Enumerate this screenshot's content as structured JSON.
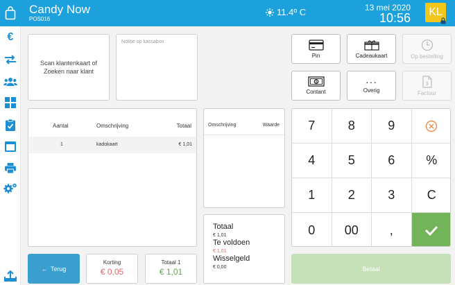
{
  "header": {
    "title": "Candy Now",
    "subtitle": "POS016",
    "temperature": "11.4º C",
    "date": "13 mei 2020",
    "time": "10:56",
    "user_initials": "KL",
    "accent_color": "#1da1dc",
    "avatar_color": "#f3c61b"
  },
  "sidebar": {
    "items": [
      {
        "icon": "euro-icon"
      },
      {
        "icon": "transfer-arrows-icon"
      },
      {
        "icon": "customers-icon"
      },
      {
        "icon": "grid-icon"
      },
      {
        "icon": "checklist-icon"
      },
      {
        "icon": "window-icon"
      },
      {
        "icon": "printer-icon"
      },
      {
        "icon": "settings-gears-icon"
      },
      {
        "icon": "upload-icon"
      }
    ]
  },
  "scan": {
    "text": "Scan klantenkaart of Zoeken naar klant"
  },
  "note": {
    "placeholder": "Notitie op kassabon"
  },
  "orders": {
    "headers": {
      "qty": "Aantal",
      "desc": "Omschrijving",
      "total": "Totaal"
    },
    "rows": [
      {
        "qty": "1",
        "desc": "kadokaart",
        "total": "€ 1,01"
      }
    ]
  },
  "vouchers": {
    "headers": {
      "desc": "Omschrijving",
      "value": "Waarde"
    }
  },
  "totals": {
    "total_label": "Totaal",
    "total_value": "€ 1,01",
    "due_label": "Te voldoen",
    "due_value": "€ 1,01",
    "change_label": "Wisselgeld",
    "change_value": "€ 0,00"
  },
  "buttons": {
    "back_label": "Terug",
    "discount_label": "Korting",
    "discount_value": "€ 0,05",
    "total1_label": "Totaal 1",
    "total1_value": "€ 1,01",
    "pay_label": "Betaal"
  },
  "payment_methods": {
    "pin": "Pin",
    "giftcard": "Cadeaukaart",
    "on_order": "Op bestelling",
    "cash": "Contant",
    "other": "Overig",
    "invoice": "Factuur"
  },
  "numpad": {
    "keys": [
      "7",
      "8",
      "9",
      "4",
      "5",
      "6",
      "%",
      "1",
      "2",
      "3",
      "C",
      "0",
      "00",
      ","
    ]
  },
  "colors": {
    "discount": "#e06b6b",
    "total1": "#5ea848",
    "due": "#e06b6b",
    "clear_key": "#f08a4b",
    "ok_key": "#73b35a"
  }
}
